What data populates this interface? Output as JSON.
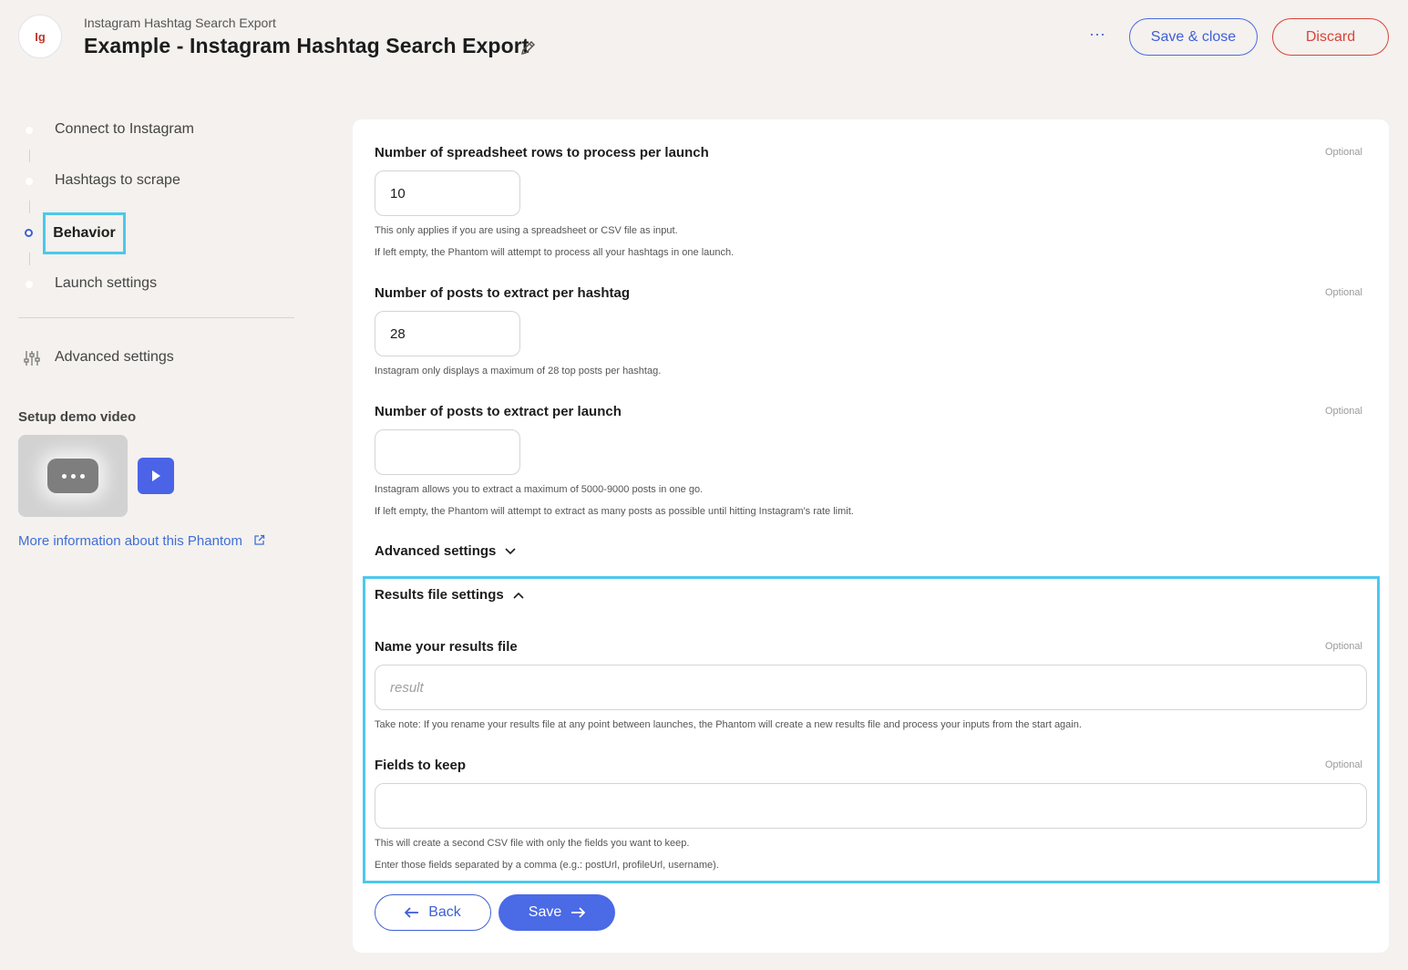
{
  "header": {
    "logo_text": "Ig",
    "subtitle": "Instagram Hashtag Search Export",
    "title": "Example - Instagram Hashtag Search Export",
    "more_label": "···",
    "save_close_label": "Save & close",
    "discard_label": "Discard"
  },
  "sidebar": {
    "steps": [
      {
        "label": "Connect to Instagram",
        "active": false
      },
      {
        "label": "Hashtags to scrape",
        "active": false
      },
      {
        "label": "Behavior",
        "active": true
      },
      {
        "label": "Launch settings",
        "active": false
      }
    ],
    "advanced_settings_label": "Advanced settings",
    "demo_video_title": "Setup demo video",
    "more_info_link": "More information about this Phantom"
  },
  "form": {
    "rows_per_launch": {
      "label": "Number of spreadsheet rows to process per launch",
      "optional": "Optional",
      "value": "10",
      "hints": [
        "This only applies if you are using a spreadsheet or CSV file as input.",
        "If left empty, the Phantom will attempt to process all your hashtags in one launch."
      ]
    },
    "posts_per_hashtag": {
      "label": "Number of posts to extract per hashtag",
      "optional": "Optional",
      "value": "28",
      "hints": [
        "Instagram only displays a maximum of 28 top posts per hashtag."
      ]
    },
    "posts_per_launch": {
      "label": "Number of posts to extract per launch",
      "optional": "Optional",
      "value": "",
      "hints": [
        "Instagram allows you to extract a maximum of 5000-9000 posts in one go.",
        "If left empty, the Phantom will attempt to extract as many posts as possible until hitting Instagram's rate limit."
      ]
    },
    "advanced_settings_toggle": "Advanced settings",
    "results_file_toggle": "Results file settings",
    "results_file_name": {
      "label": "Name your results file",
      "optional": "Optional",
      "placeholder": "result",
      "value": "",
      "hints": [
        "Take note: If you rename your results file at any point between launches, the Phantom will create a new results file and process your inputs from the start again."
      ]
    },
    "fields_to_keep": {
      "label": "Fields to keep",
      "optional": "Optional",
      "value": "",
      "hints": [
        "This will create a second CSV file with only the fields you want to keep.",
        "Enter those fields separated by a comma (e.g.: postUrl, profileUrl, username)."
      ]
    },
    "back_label": "Back",
    "save_label": "Save"
  },
  "colors": {
    "accent": "#4a6ae6",
    "danger": "#d9443a",
    "highlight": "#4cc8ec",
    "background": "#f4f1ee"
  }
}
